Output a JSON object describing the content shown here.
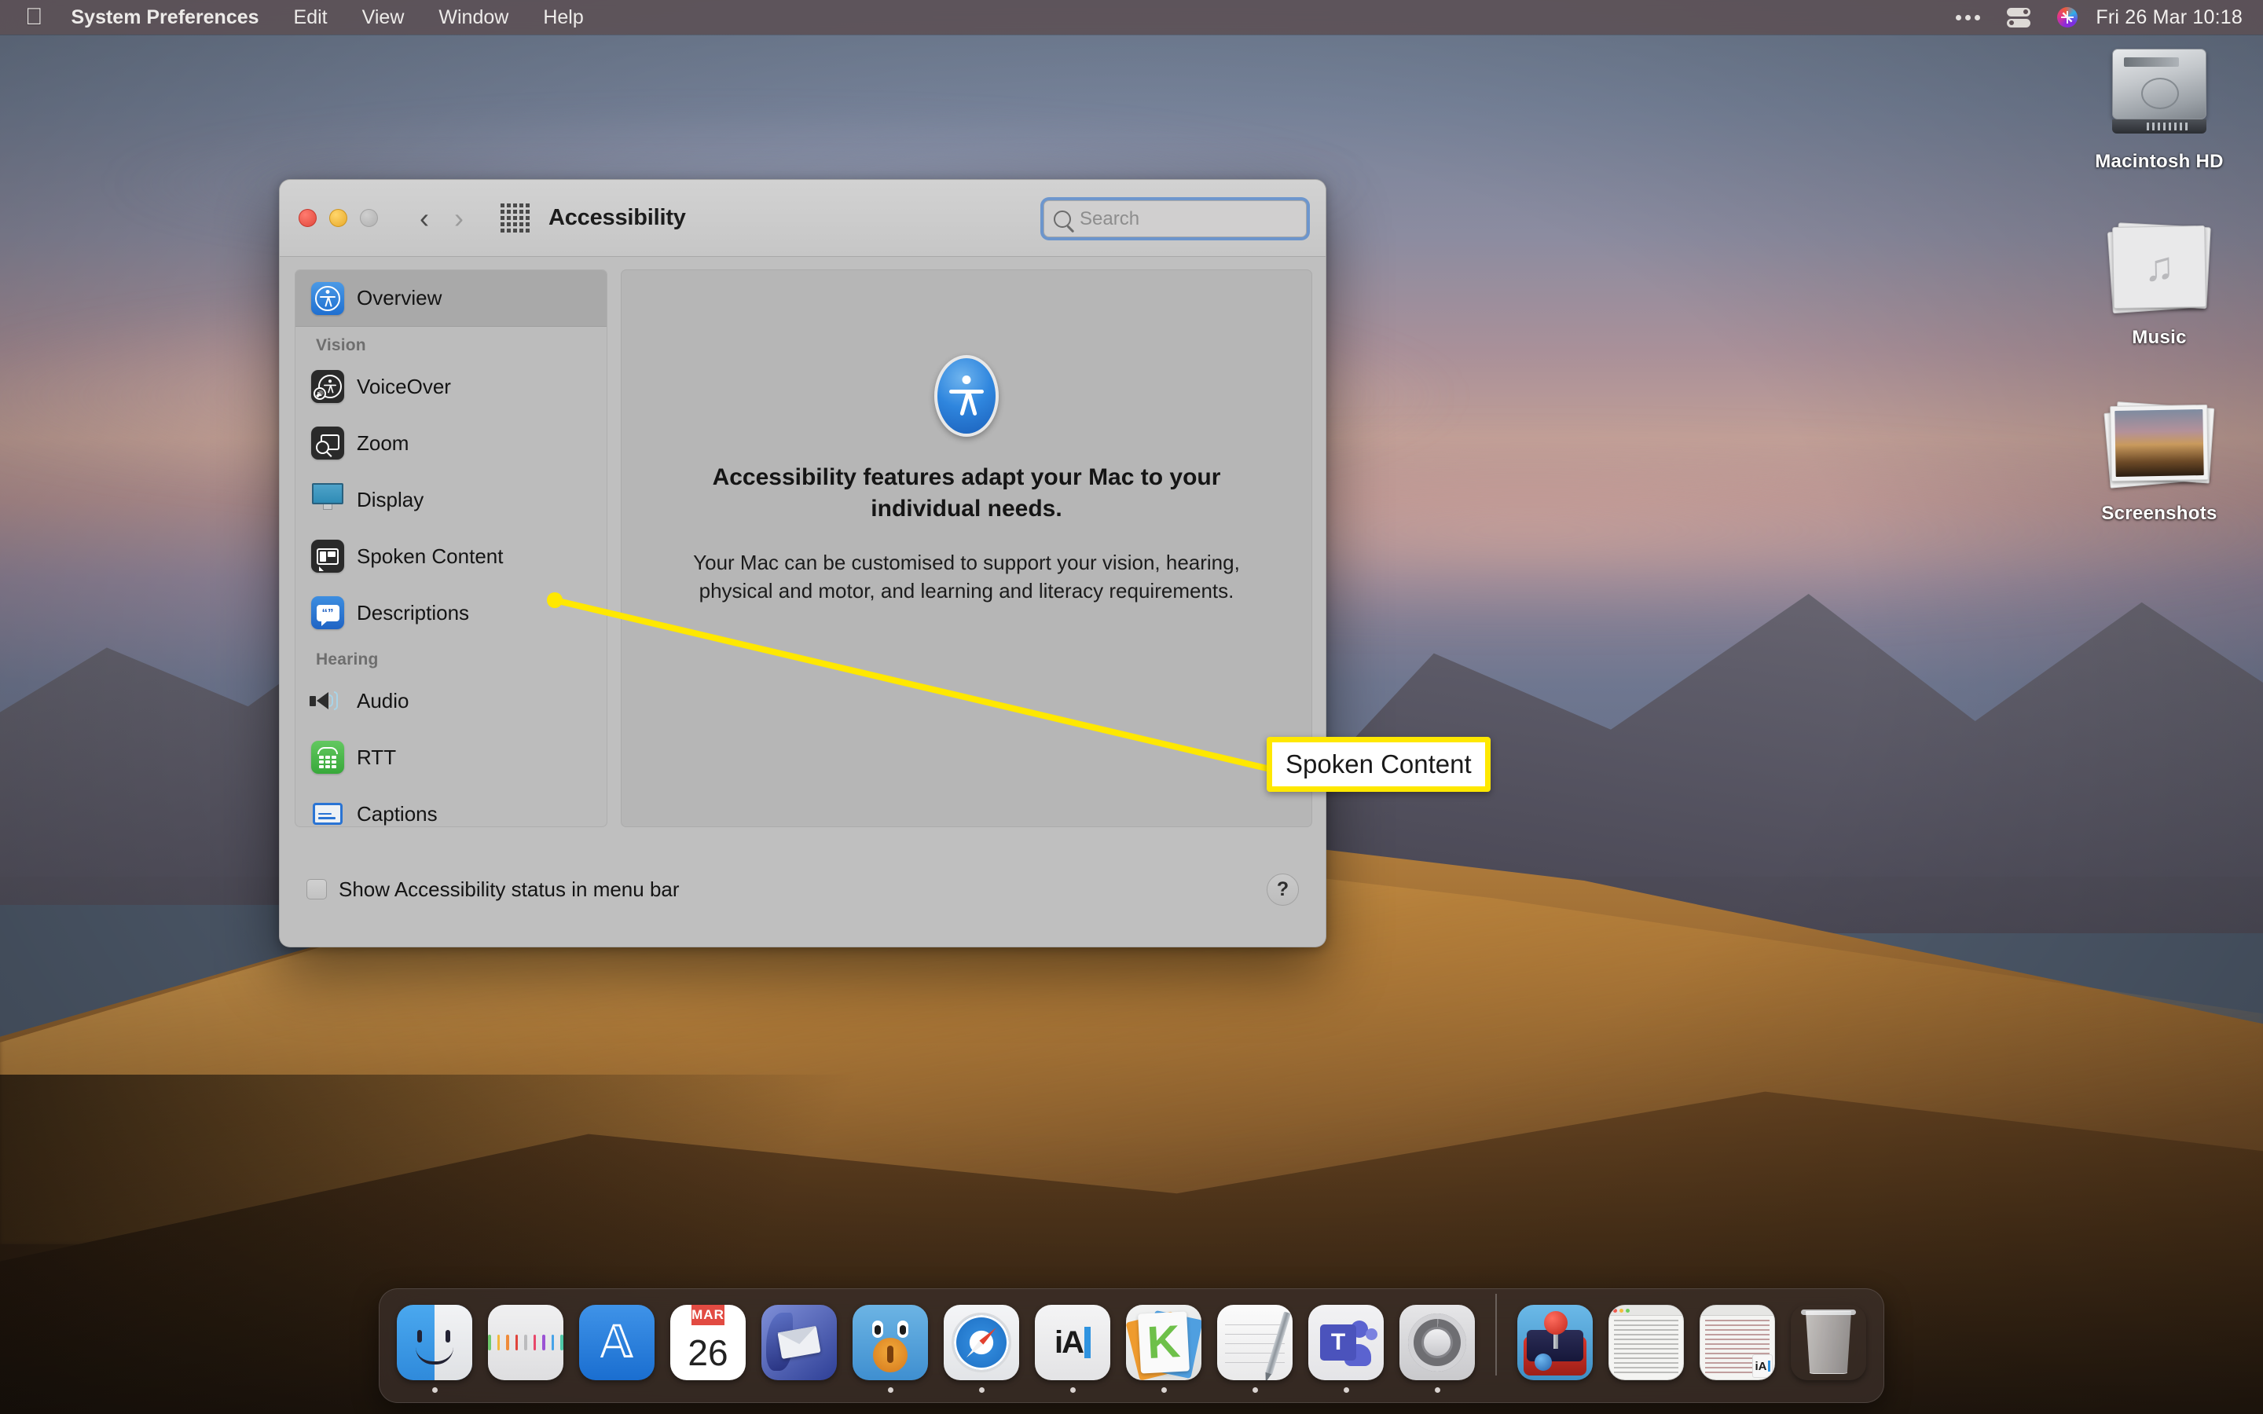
{
  "menubar": {
    "apple_icon": "apple-logo-icon",
    "items": [
      {
        "label": "System Preferences",
        "bold": true
      },
      {
        "label": "Edit",
        "bold": false
      },
      {
        "label": "View",
        "bold": false
      },
      {
        "label": "Window",
        "bold": false
      },
      {
        "label": "Help",
        "bold": false
      }
    ],
    "right": {
      "overflow_icon": "ellipsis-icon",
      "control_center_icon": "control-center-icon",
      "siri_icon": "siri-icon",
      "clock": "Fri 26 Mar  10:18"
    }
  },
  "desktop": {
    "icons": [
      {
        "label": "Macintosh HD",
        "icon": "hard-drive-icon"
      },
      {
        "label": "Music",
        "icon": "music-folder-stack-icon"
      },
      {
        "label": "Screenshots",
        "icon": "screenshots-stack-icon"
      }
    ]
  },
  "window": {
    "title": "Accessibility",
    "traffic_lights": [
      "close-button",
      "minimize-button",
      "zoom-button"
    ],
    "nav": {
      "back_icon": "chevron-left-icon",
      "forward_icon": "chevron-right-icon",
      "grid_icon": "show-all-grid-icon"
    },
    "search": {
      "placeholder": "Search",
      "value": "",
      "icon": "search-icon",
      "focused": true
    },
    "sidebar": {
      "selected": "Overview",
      "rows": [
        {
          "type": "item",
          "label": "Overview",
          "icon": "accessibility-icon",
          "selected": true
        },
        {
          "type": "header",
          "label": "Vision"
        },
        {
          "type": "item",
          "label": "VoiceOver",
          "icon": "voiceover-icon",
          "selected": false
        },
        {
          "type": "item",
          "label": "Zoom",
          "icon": "zoom-icon",
          "selected": false
        },
        {
          "type": "item",
          "label": "Display",
          "icon": "display-icon",
          "selected": false
        },
        {
          "type": "item",
          "label": "Spoken Content",
          "icon": "spoken-content-icon",
          "selected": false
        },
        {
          "type": "item",
          "label": "Descriptions",
          "icon": "descriptions-icon",
          "selected": false
        },
        {
          "type": "header",
          "label": "Hearing"
        },
        {
          "type": "item",
          "label": "Audio",
          "icon": "audio-icon",
          "selected": false
        },
        {
          "type": "item",
          "label": "RTT",
          "icon": "rtt-icon",
          "selected": false
        },
        {
          "type": "item",
          "label": "Captions",
          "icon": "captions-icon",
          "selected": false
        }
      ]
    },
    "content": {
      "icon": "accessibility-large-icon",
      "headline": "Accessibility features adapt your Mac to your individual needs.",
      "subtext": "Your Mac can be customised to support your vision, hearing, physical and motor, and learning and literacy requirements."
    },
    "footer": {
      "checkbox_label": "Show Accessibility status in menu bar",
      "checkbox_checked": false,
      "help_label": "?"
    }
  },
  "annotation": {
    "callout_text": "Spoken Content",
    "border_color": "#ffe800",
    "line_color": "#ffe800",
    "background": "#ffffff"
  },
  "dock": {
    "items": [
      {
        "name": "Finder",
        "running": true
      },
      {
        "name": "Launchpad",
        "running": false
      },
      {
        "name": "App Store",
        "running": false
      },
      {
        "name": "Calendar",
        "month": "MAR",
        "day": "26",
        "running": false
      },
      {
        "name": "Thunderbird",
        "running": false
      },
      {
        "name": "Tweetbot",
        "running": true
      },
      {
        "name": "Safari",
        "running": true
      },
      {
        "name": "iA Writer",
        "running": true
      },
      {
        "name": "Kindle",
        "running": true
      },
      {
        "name": "Notes",
        "running": true
      },
      {
        "name": "Microsoft Teams",
        "running": true
      },
      {
        "name": "System Preferences",
        "running": true
      }
    ],
    "minimized": [
      {
        "name": "OpenEmu"
      },
      {
        "name": "Notes Document Window"
      },
      {
        "name": "iA Writer Document Window"
      }
    ],
    "trash": {
      "name": "Trash"
    }
  }
}
